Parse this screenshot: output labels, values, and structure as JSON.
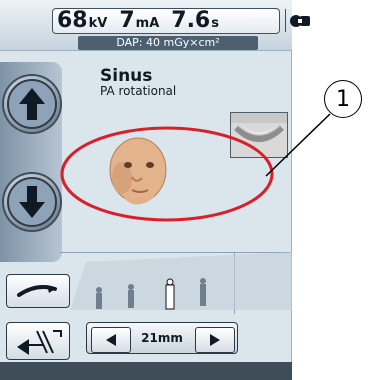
{
  "parameters": {
    "kv_value": "68",
    "kv_unit": "kV",
    "ma_value": "7",
    "ma_unit": "mA",
    "time_value": "7.6",
    "time_unit": "s"
  },
  "dap_text": "DAP: 40 mGy×cm²",
  "exam": {
    "title": "Sinus",
    "subtitle": "PA rotational"
  },
  "size_control": {
    "value": "21mm"
  },
  "callout": {
    "number": "1"
  },
  "colors": {
    "highlight": "#d7202a",
    "panel": "#dbe5ec"
  },
  "icons": {
    "up": "arrow-up-icon",
    "down": "arrow-down-icon",
    "rotate": "rotate-arrow-icon",
    "collimation": "collimation-icon",
    "left": "left-arrow-icon",
    "right": "right-arrow-icon",
    "settings": "device-settings-icon"
  }
}
